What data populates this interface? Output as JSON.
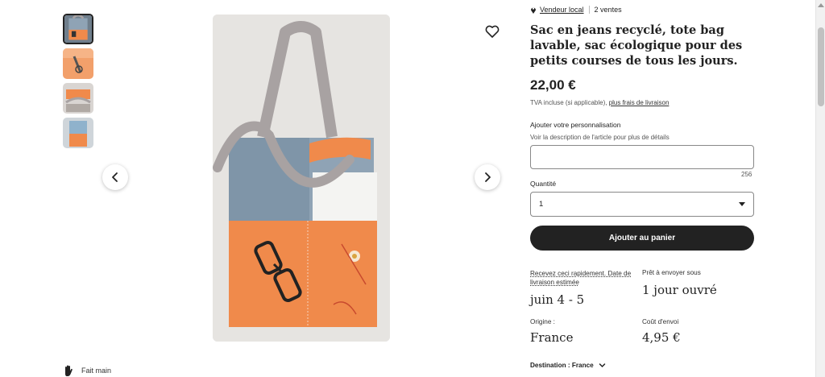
{
  "seller": {
    "badge_label": "Vendeur local",
    "sales": "2 ventes"
  },
  "product": {
    "title": "Sac en jeans recyclé, tote bag lavable, sac écologique pour des petits courses de tous les jours.",
    "price": "22,00 €",
    "vat_text": "TVA incluse (si applicable),",
    "shipping_link": "plus frais de livraison"
  },
  "personalization": {
    "label": "Ajouter votre personnalisation",
    "hint": "Voir la description de l'article pour plus de détails",
    "value": "",
    "char_count": "256"
  },
  "quantity": {
    "label": "Quantité",
    "selected": "1"
  },
  "cart_button": "Ajouter au panier",
  "delivery": {
    "estimate_label": "Recevez ceci rapidement. Date de livraison estimée",
    "estimate_value": "juin 4 - 5",
    "ready_label": "Prêt à envoyer sous",
    "ready_value": "1 jour ouvré",
    "origin_label": "Origine :",
    "origin_value": "France",
    "cost_label": "Coût d'envoi",
    "cost_value": "4,95 €",
    "destination": "Destination : France"
  },
  "badges": {
    "handmade": "Fait main"
  },
  "icons": {
    "favorite": "heart-icon",
    "prev": "chevron-left-icon",
    "next": "chevron-right-icon",
    "location": "map-pin-icon",
    "handmade": "hand-icon",
    "dropdown": "chevron-down-icon"
  },
  "colors": {
    "bag_orange": "#f08a4b",
    "denim": "#8fa3b5",
    "strap": "#a8a2a2",
    "button_dark": "#222222"
  }
}
